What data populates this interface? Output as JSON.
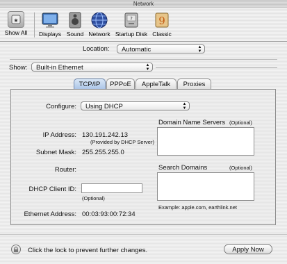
{
  "window": {
    "title": "Network"
  },
  "toolbar": {
    "items": [
      {
        "label": "Show All",
        "icon": "show-all-icon"
      },
      {
        "label": "Displays",
        "icon": "displays-icon"
      },
      {
        "label": "Sound",
        "icon": "sound-icon"
      },
      {
        "label": "Network",
        "icon": "network-globe-icon"
      },
      {
        "label": "Startup Disk",
        "icon": "startup-disk-icon"
      },
      {
        "label": "Classic",
        "icon": "classic-icon"
      }
    ]
  },
  "location": {
    "label": "Location:",
    "value": "Automatic"
  },
  "show": {
    "label": "Show:",
    "value": "Built-in Ethernet"
  },
  "tabs": [
    "TCP/IP",
    "PPPoE",
    "AppleTalk",
    "Proxies"
  ],
  "active_tab": "TCP/IP",
  "tcpip": {
    "configure_label": "Configure:",
    "configure_value": "Using DHCP",
    "ip_label": "IP Address:",
    "ip_value": "130.191.242.13",
    "ip_note": "(Provided by DHCP Server)",
    "subnet_label": "Subnet Mask:",
    "subnet_value": "255.255.255.0",
    "router_label": "Router:",
    "router_value": "",
    "dhcp_label": "DHCP Client ID:",
    "dhcp_value": "",
    "dhcp_note": "(Optional)",
    "ethernet_label": "Ethernet Address:",
    "ethernet_value": "00:03:93:00:72:34",
    "dns_label": "Domain Name Servers",
    "dns_optional": "(Optional)",
    "search_label": "Search Domains",
    "search_optional": "(Optional)",
    "example": "Example: apple.com, earthlink.net"
  },
  "footer": {
    "lock_text": "Click the lock to prevent further changes.",
    "apply_label": "Apply Now"
  }
}
